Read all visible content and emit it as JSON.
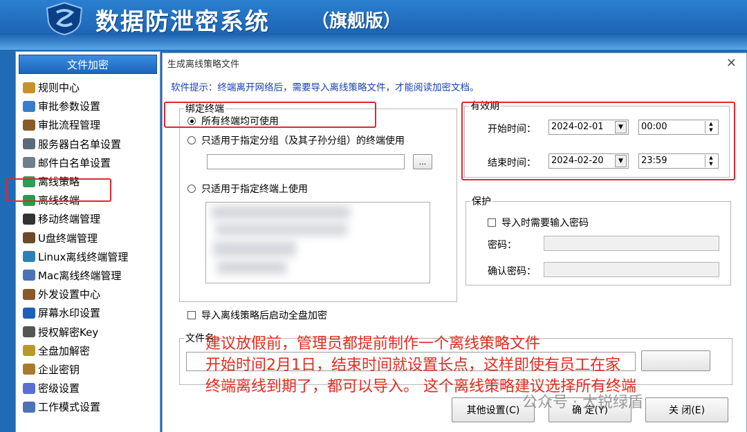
{
  "header": {
    "title": "数据防泄密系统",
    "edition": "（旗舰版）"
  },
  "sidebar": {
    "section_title": "文件加密",
    "items": [
      {
        "label": "规则中心",
        "icon": "rules-icon"
      },
      {
        "label": "审批参数设置",
        "icon": "approval-params-icon"
      },
      {
        "label": "审批流程管理",
        "icon": "gear-icon"
      },
      {
        "label": "服务器白名单设置",
        "icon": "server-icon"
      },
      {
        "label": "邮件白名单设置",
        "icon": "mail-icon"
      },
      {
        "label": "离线策略",
        "icon": "offline-policy-icon"
      },
      {
        "label": "离线终端",
        "icon": "check-shield-icon"
      },
      {
        "label": "移动终端管理",
        "icon": "mobile-icon"
      },
      {
        "label": "U盘终端管理",
        "icon": "usb-icon"
      },
      {
        "label": "Linux离线终端管理",
        "icon": "linux-icon"
      },
      {
        "label": "Mac离线终端管理",
        "icon": "monitor-icon"
      },
      {
        "label": "外发设置中心",
        "icon": "gear-icon"
      },
      {
        "label": "屏幕水印设置",
        "icon": "screen-icon"
      },
      {
        "label": "授权解密Key",
        "icon": "key-icon"
      },
      {
        "label": "全盘加解密",
        "icon": "disk-icon"
      },
      {
        "label": "企业密钥",
        "icon": "lock-icon"
      },
      {
        "label": "密级设置",
        "icon": "level-icon"
      },
      {
        "label": "工作模式设置",
        "icon": "monitor-icon"
      }
    ]
  },
  "dialog": {
    "title": "生成离线策略文件",
    "hint": "软件提示：终端离开网络后，需要导入离线策略文件，才能阅读加密文档。",
    "bind": {
      "legend": "绑定终端",
      "opt_all": "所有终端均可使用",
      "opt_group": "只适用于指定分组（及其子孙分组）的终端使用",
      "browse": "...",
      "opt_specific": "只适用于指定终端上使用"
    },
    "validity": {
      "legend": "有效期",
      "start_label": "开始时间：",
      "start_date": "2024-02-01",
      "start_time": "00:00",
      "end_label": "结束时间：",
      "end_date": "2024-02-20",
      "end_time": "23:59"
    },
    "protect": {
      "legend": "保护",
      "need_pwd": "导入时需要输入密码",
      "pwd_label": "密码：",
      "confirm_label": "确认密码："
    },
    "full_disk": "导入离线策略后启动全盘加密",
    "file_legend": "文件名",
    "buttons": {
      "other": "其他设置(C)",
      "ok": "确  定(Y)",
      "close": "关  闭(E)"
    }
  },
  "annotation": {
    "lines": [
      "建议放假前，管理员都提前制作一个离线策略文件",
      "开始时间2月1日，结束时间就设置长点，这样即使有员工在家",
      "终端离线到期了，都可以导入。 这个离线策略建议选择所有终端"
    ]
  },
  "watermark": "公众号 · 大锐绿盾"
}
